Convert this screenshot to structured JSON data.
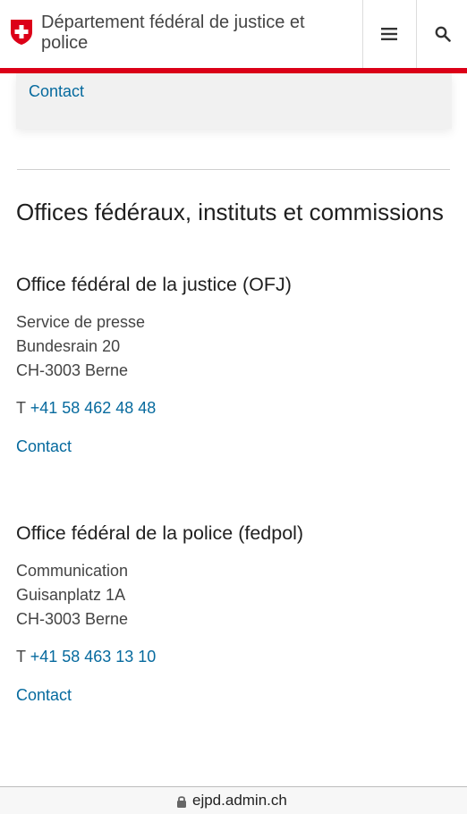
{
  "header": {
    "department": "Département fédéral de justice et police",
    "menu_icon": "hamburger-menu-icon",
    "search_icon": "search-icon",
    "accent_color": "#dc0018"
  },
  "top_card": {
    "contact_link": "Contact"
  },
  "section": {
    "title": "Offices fédéraux, instituts et commissions",
    "offices": [
      {
        "name": "Office fédéral de la justice (OFJ)",
        "address": [
          "Service de presse",
          "Bundesrain 20",
          "CH-3003 Berne"
        ],
        "phone_prefix": "T",
        "phone": "+41 58 462 48 48",
        "contact": "Contact"
      },
      {
        "name": "Office fédéral de la police (fedpol)",
        "address": [
          "Communication",
          "Guisanplatz 1A",
          "CH-3003 Berne"
        ],
        "phone_prefix": "T",
        "phone": "+41 58 463 13 10",
        "contact": "Contact"
      }
    ]
  },
  "browser": {
    "url": "ejpd.admin.ch",
    "lock_icon": "lock-icon"
  },
  "link_color": "#066a9e"
}
